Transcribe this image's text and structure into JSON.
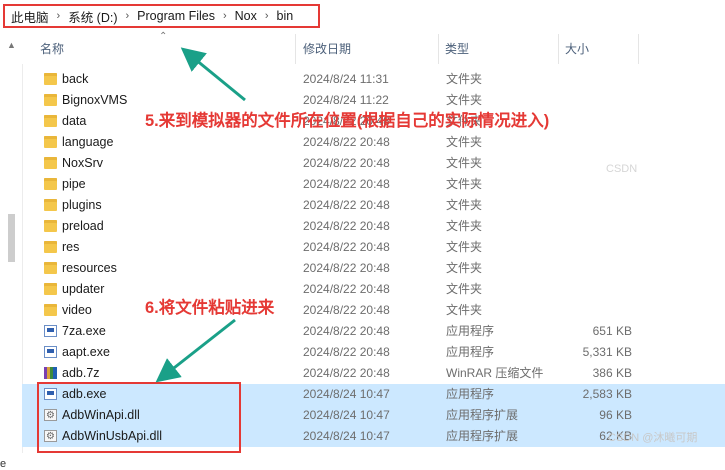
{
  "address_bar": {
    "crumbs": [
      "此电脑",
      "系统 (D:)",
      "Program Files",
      "Nox",
      "bin"
    ],
    "separator": "›"
  },
  "columns": {
    "name": "名称",
    "date": "修改日期",
    "type": "类型",
    "size": "大小"
  },
  "files": [
    {
      "name": "back",
      "date": "2024/8/24 11:31",
      "type": "文件夹",
      "size": "",
      "icon": "folder-icon"
    },
    {
      "name": "BignoxVMS",
      "date": "2024/8/24 11:22",
      "type": "文件夹",
      "size": "",
      "icon": "folder-icon"
    },
    {
      "name": "data",
      "date": "2024/8/22 20:48",
      "type": "文件夹",
      "size": "",
      "icon": "folder-icon"
    },
    {
      "name": "language",
      "date": "2024/8/22 20:48",
      "type": "文件夹",
      "size": "",
      "icon": "folder-icon"
    },
    {
      "name": "NoxSrv",
      "date": "2024/8/22 20:48",
      "type": "文件夹",
      "size": "",
      "icon": "folder-icon"
    },
    {
      "name": "pipe",
      "date": "2024/8/22 20:48",
      "type": "文件夹",
      "size": "",
      "icon": "folder-icon"
    },
    {
      "name": "plugins",
      "date": "2024/8/22 20:48",
      "type": "文件夹",
      "size": "",
      "icon": "folder-icon"
    },
    {
      "name": "preload",
      "date": "2024/8/22 20:48",
      "type": "文件夹",
      "size": "",
      "icon": "folder-icon"
    },
    {
      "name": "res",
      "date": "2024/8/22 20:48",
      "type": "文件夹",
      "size": "",
      "icon": "folder-icon"
    },
    {
      "name": "resources",
      "date": "2024/8/22 20:48",
      "type": "文件夹",
      "size": "",
      "icon": "folder-icon"
    },
    {
      "name": "updater",
      "date": "2024/8/22 20:48",
      "type": "文件夹",
      "size": "",
      "icon": "folder-icon"
    },
    {
      "name": "video",
      "date": "2024/8/22 20:48",
      "type": "文件夹",
      "size": "",
      "icon": "folder-icon"
    },
    {
      "name": "7za.exe",
      "date": "2024/8/22 20:48",
      "type": "应用程序",
      "size": "651 KB",
      "icon": "exe-icon"
    },
    {
      "name": "aapt.exe",
      "date": "2024/8/22 20:48",
      "type": "应用程序",
      "size": "5,331 KB",
      "icon": "exe-icon"
    },
    {
      "name": "adb.7z",
      "date": "2024/8/22 20:48",
      "type": "WinRAR 压缩文件",
      "size": "386 KB",
      "icon": "archive-icon"
    },
    {
      "name": "adb.exe",
      "date": "2024/8/24 10:47",
      "type": "应用程序",
      "size": "2,583 KB",
      "icon": "exe-icon",
      "selected": true
    },
    {
      "name": "AdbWinApi.dll",
      "date": "2024/8/24 10:47",
      "type": "应用程序扩展",
      "size": "96 KB",
      "icon": "dll-icon",
      "selected": true
    },
    {
      "name": "AdbWinUsbApi.dll",
      "date": "2024/8/24 10:47",
      "type": "应用程序扩展",
      "size": "62 KB",
      "icon": "dll-icon",
      "selected": true
    }
  ],
  "annotations": {
    "step5": "5.来到模拟器的文件所在位置(根据自己的实际情况进入)",
    "step6": "6.将文件粘贴进来",
    "arrow_color": "#1aa088",
    "highlight_color": "#e53935"
  },
  "watermark": "CSDN @沐曦可期",
  "watermark_side": "CSDN",
  "left_strip_text": "e",
  "colors": {
    "selected_row": "#cce8ff",
    "header_text": "#4c607a",
    "folder": "#f4c74b"
  }
}
